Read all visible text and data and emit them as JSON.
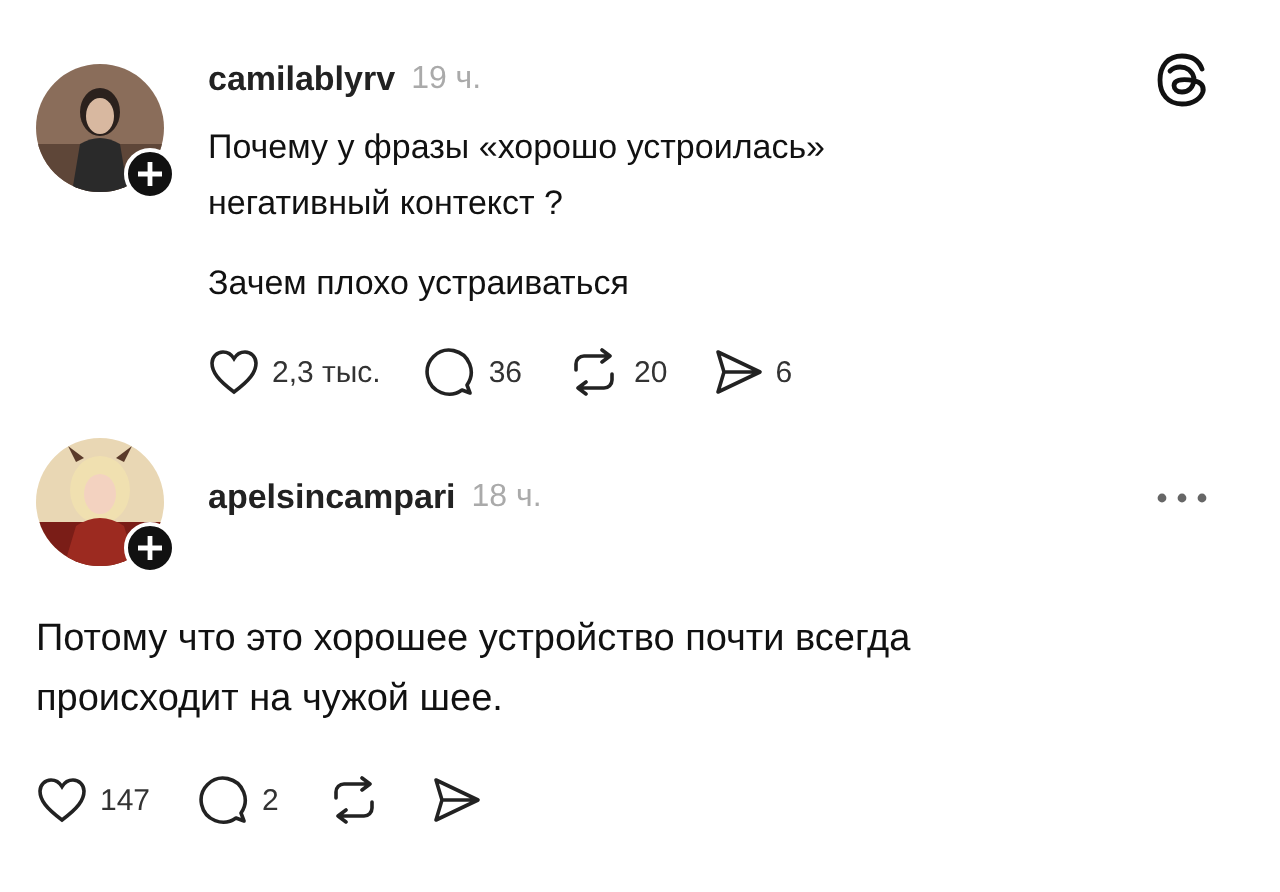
{
  "posts": [
    {
      "kind": "indented",
      "username": "camilablyrv",
      "time": "19 ч.",
      "corner_icon": {
        "kind": "logo"
      },
      "paragraphs": [
        "Почему у фразы «хорошо устроилась»\nнегативный контекст ?",
        "Зачем плохо устраиваться"
      ],
      "actions": [
        {
          "kind": "like",
          "count": "2,3 тыс."
        },
        {
          "kind": "comment",
          "count": "36"
        },
        {
          "kind": "repost",
          "count": "20"
        },
        {
          "kind": "share",
          "count": "6"
        }
      ]
    },
    {
      "kind": "full",
      "username": "apelsincampari",
      "time": "18 ч.",
      "corner_icon": {
        "kind": "more"
      },
      "paragraphs": [
        "Потому что это хорошее устройство почти всегда\nпроисходит на чужой шее."
      ],
      "actions": [
        {
          "kind": "like",
          "count": "147"
        },
        {
          "kind": "comment",
          "count": "2"
        },
        {
          "kind": "repost"
        },
        {
          "kind": "share"
        }
      ]
    }
  ]
}
